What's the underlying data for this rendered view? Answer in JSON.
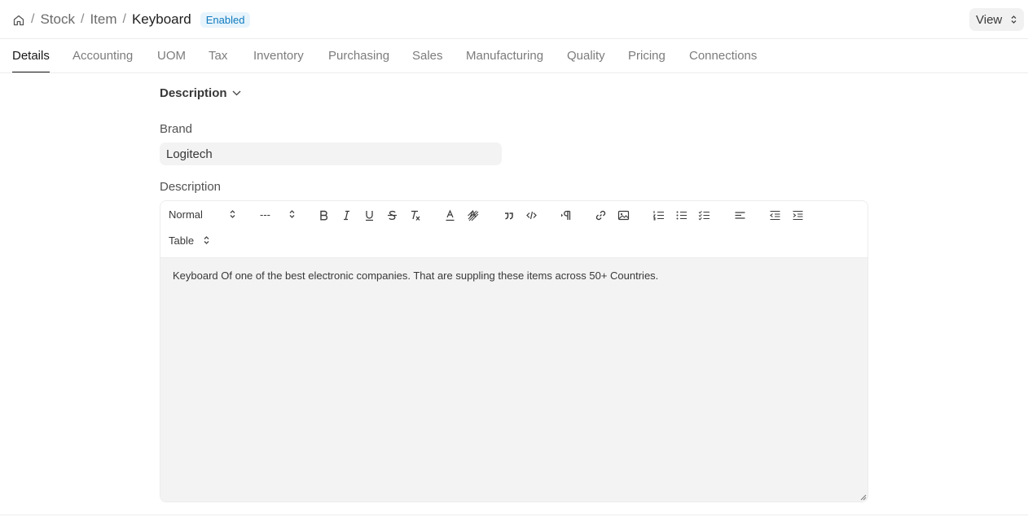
{
  "breadcrumb": {
    "home_icon": "home-icon",
    "separator": "/",
    "items": [
      "Stock",
      "Item"
    ],
    "current": "Keyboard",
    "status_badge": "Enabled"
  },
  "view_button": {
    "label": "View"
  },
  "tabs": [
    {
      "label": "Details",
      "active": true
    },
    {
      "label": "Accounting"
    },
    {
      "label": "UOM"
    },
    {
      "label": "Tax"
    },
    {
      "label": "Inventory"
    },
    {
      "label": "Purchasing"
    },
    {
      "label": "Sales"
    },
    {
      "label": "Manufacturing"
    },
    {
      "label": "Quality"
    },
    {
      "label": "Pricing"
    },
    {
      "label": "Connections"
    }
  ],
  "section": {
    "title": "Description"
  },
  "fields": {
    "brand": {
      "label": "Brand",
      "value": "Logitech"
    },
    "description": {
      "label": "Description",
      "value": "Keyboard Of one of the best electronic companies. That are suppling these items across 50+ Countries."
    }
  },
  "toolbar": {
    "format_select": "Normal",
    "size_select": "---",
    "table_select": "Table",
    "buttons": [
      "bold-icon",
      "italic-icon",
      "underline-icon",
      "strikethrough-icon",
      "clear-format-icon",
      "text-color-icon",
      "background-color-icon",
      "blockquote-icon",
      "code-icon",
      "direction-icon",
      "link-icon",
      "image-icon",
      "ordered-list-icon",
      "bullet-list-icon",
      "check-list-icon",
      "align-icon",
      "outdent-icon",
      "indent-icon"
    ]
  },
  "colors": {
    "badge_bg": "#e8f4fc",
    "badge_text": "#0f7bbf",
    "input_bg": "#f3f3f3",
    "active_tab": "#171717"
  }
}
